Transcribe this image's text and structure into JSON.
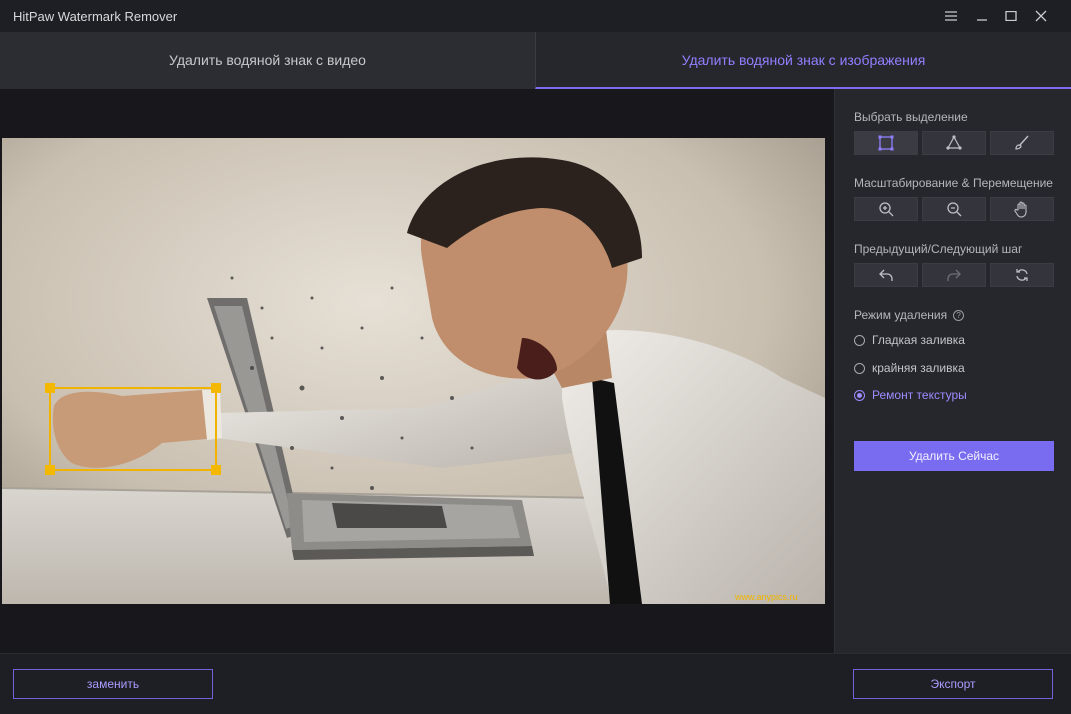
{
  "window": {
    "title": "HitPaw Watermark Remover"
  },
  "tabs": [
    {
      "label": "Удалить водяной знак с видео",
      "active": false
    },
    {
      "label": "Удалить водяной знак с изображения",
      "active": true
    }
  ],
  "image": {
    "watermark_text": "www.anypics.ru"
  },
  "panel": {
    "selection_label": "Выбрать выделение",
    "selection_tools": [
      "rectangle-select-icon",
      "polygon-lasso-icon",
      "brush-icon"
    ],
    "zoom_label": "Масштабирование & Перемещение",
    "zoom_tools": [
      "zoom-in-icon",
      "zoom-out-icon",
      "hand-pan-icon"
    ],
    "step_label": "Предыдущий/Следующий шаг",
    "step_tools": [
      "undo-icon",
      "redo-icon",
      "reset-icon"
    ],
    "mode_label": "Режим удаления",
    "modes": [
      {
        "label": "Гладкая заливка",
        "selected": false
      },
      {
        "label": "крайняя заливка",
        "selected": false
      },
      {
        "label": "Ремонт текстуры",
        "selected": true
      }
    ],
    "remove_button": "Удалить Сейчас"
  },
  "footer": {
    "replace_button": "заменить",
    "export_button": "Экспорт"
  },
  "colors": {
    "accent": "#7a6cf0",
    "selection_box": "#f0b400",
    "background": "#1b1b1f",
    "panel": "#26272d"
  }
}
